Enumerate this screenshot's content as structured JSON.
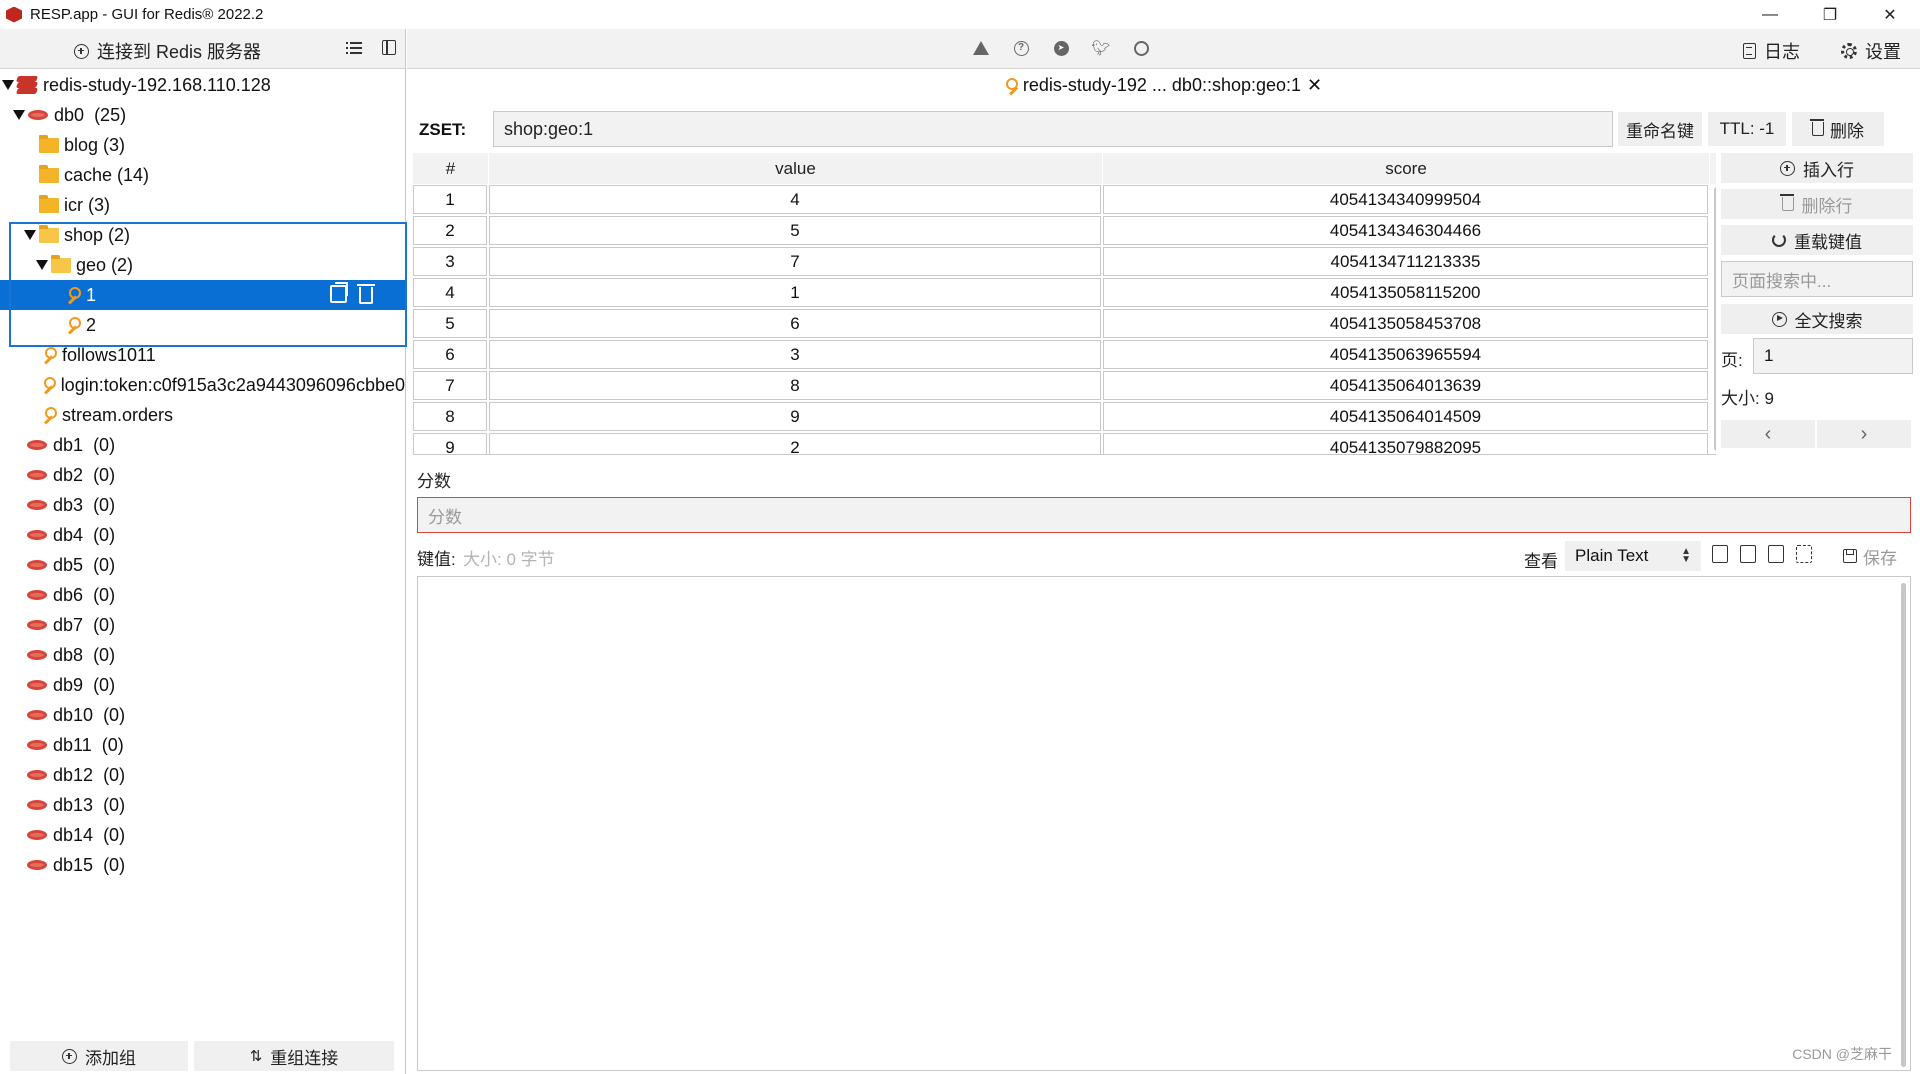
{
  "window": {
    "title": "RESP.app - GUI for Redis® 2022.2",
    "controls": {
      "minimize": "—",
      "restore": "❐",
      "close": "✕"
    }
  },
  "left_panel": {
    "connect_label": "连接到 Redis 服务器",
    "tree": {
      "server": "redis-study-192.168.110.128",
      "db0": {
        "name": "db0",
        "count": "(25)"
      },
      "folders": [
        {
          "name": "blog (3)"
        },
        {
          "name": "cache (14)"
        },
        {
          "name": "icr (3)"
        }
      ],
      "shop": "shop (2)",
      "geo": "geo (2)",
      "geo_keys": [
        "1",
        "2"
      ],
      "keys": [
        "follows1011",
        "login:token:c0f915a3c2a9443096096cbbe0",
        "stream.orders"
      ],
      "dbs": [
        {
          "name": "db1",
          "count": "(0)"
        },
        {
          "name": "db2",
          "count": "(0)"
        },
        {
          "name": "db3",
          "count": "(0)"
        },
        {
          "name": "db4",
          "count": "(0)"
        },
        {
          "name": "db5",
          "count": "(0)"
        },
        {
          "name": "db6",
          "count": "(0)"
        },
        {
          "name": "db7",
          "count": "(0)"
        },
        {
          "name": "db8",
          "count": "(0)"
        },
        {
          "name": "db9",
          "count": "(0)"
        },
        {
          "name": "db10",
          "count": "(0)"
        },
        {
          "name": "db11",
          "count": "(0)"
        },
        {
          "name": "db12",
          "count": "(0)"
        },
        {
          "name": "db13",
          "count": "(0)"
        },
        {
          "name": "db14",
          "count": "(0)"
        },
        {
          "name": "db15",
          "count": "(0)"
        }
      ]
    },
    "add_group_label": "添加组",
    "regroup_label": "重组连接"
  },
  "toolbar": {
    "icons": [
      "warning-icon",
      "help-icon",
      "telegram-icon",
      "twitter-icon",
      "github-icon"
    ],
    "log_label": "日志",
    "settings_label": "设置"
  },
  "tab": {
    "label": "redis-study-192 ... db0::shop:geo:1",
    "close": "✕"
  },
  "key": {
    "type_label": "ZSET:",
    "name": "shop:geo:1",
    "rename_label": "重命名键",
    "ttl_label": "TTL:  -1",
    "delete_label": "删除"
  },
  "table": {
    "headers": [
      "#",
      "value",
      "score"
    ],
    "rows": [
      {
        "idx": "1",
        "value": "4",
        "score": "4054134340999504"
      },
      {
        "idx": "2",
        "value": "5",
        "score": "4054134346304466"
      },
      {
        "idx": "3",
        "value": "7",
        "score": "4054134711213335"
      },
      {
        "idx": "4",
        "value": "1",
        "score": "4054135058115200"
      },
      {
        "idx": "5",
        "value": "6",
        "score": "4054135058453708"
      },
      {
        "idx": "6",
        "value": "3",
        "score": "4054135063965594"
      },
      {
        "idx": "7",
        "value": "8",
        "score": "4054135064013639"
      },
      {
        "idx": "8",
        "value": "9",
        "score": "4054135064014509"
      },
      {
        "idx": "9",
        "value": "2",
        "score": "4054135079882095"
      }
    ]
  },
  "actions": {
    "insert_label": "插入行",
    "delete_row_label": "删除行",
    "reload_label": "重载键值",
    "page_search_placeholder": "页面搜索中...",
    "fulltext_label": "全文搜索",
    "page_label": "页:",
    "page_value": "1",
    "size_label": "大小: 9",
    "prev": "‹",
    "next": "›"
  },
  "score_field": {
    "label": "分数",
    "placeholder": "分数"
  },
  "value_editor": {
    "label": "键值:",
    "size_hint": "大小: 0 字节",
    "view_label": "查看",
    "view_mode": "Plain Text",
    "save_label": "保存"
  },
  "watermark": "CSDN @芝麻干",
  "colors": {
    "selection": "#0a6fd4",
    "highlight_border": "#1a75d2",
    "error_border": "#e0443a",
    "db_icon": "#d6453a",
    "folder": "#f4b428",
    "key": "#f29a1e"
  }
}
